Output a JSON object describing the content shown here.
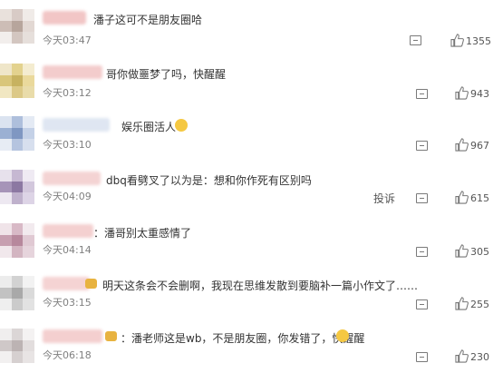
{
  "comments": [
    {
      "text": "潘子这可不是朋友圈哈",
      "time": "今天03:47",
      "likes": "1355"
    },
    {
      "text": "哥你做噩梦了吗，快醒醒",
      "time": "今天03:12",
      "likes": "943"
    },
    {
      "text": "娱乐圈活人",
      "time": "今天03:10",
      "likes": "967"
    },
    {
      "text": "dbq看劈叉了以为是：想和你作死有区别吗",
      "time": "今天04:09",
      "likes": "615",
      "report": "投诉"
    },
    {
      "text": "：潘哥别太重感情了",
      "time": "今天04:14",
      "likes": "305"
    },
    {
      "text": "明天这条会不会删啊，我现在思维发散到要脑补一篇小作文了……",
      "time": "今天03:15",
      "likes": "255"
    },
    {
      "text": "：潘老师这是wb，不是朋友圈，你发错了，快醒醒",
      "time": "今天06:18",
      "likes": "230"
    }
  ],
  "colors": {
    "avatar_palette": [
      "#c9b7ae",
      "#d7c77a",
      "#9aaccc",
      "#b8a9c4",
      "#c7a0b1",
      "#b9b9b9",
      "#c4c4c4"
    ]
  }
}
